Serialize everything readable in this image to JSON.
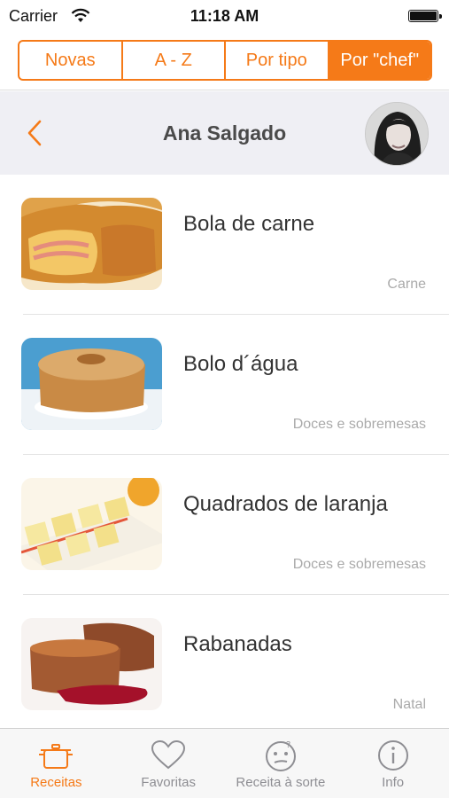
{
  "status_bar": {
    "carrier": "Carrier",
    "time": "11:18 AM"
  },
  "segments": [
    {
      "label": "Novas",
      "active": false
    },
    {
      "label": "A - Z",
      "active": false
    },
    {
      "label": "Por tipo",
      "active": false
    },
    {
      "label": "Por \"chef\"",
      "active": true
    }
  ],
  "chef": {
    "name": "Ana Salgado"
  },
  "recipes": [
    {
      "title": "Bola de carne",
      "category": "Carne"
    },
    {
      "title": "Bolo d´água",
      "category": "Doces e sobremesas"
    },
    {
      "title": "Quadrados de laranja",
      "category": "Doces e sobremesas"
    },
    {
      "title": "Rabanadas",
      "category": "Natal"
    }
  ],
  "tabs": [
    {
      "label": "Receitas",
      "icon": "pot-icon",
      "active": true
    },
    {
      "label": "Favoritas",
      "icon": "heart-icon",
      "active": false
    },
    {
      "label": "Receita à sorte",
      "icon": "thinking-face-icon",
      "active": false
    },
    {
      "label": "Info",
      "icon": "info-icon",
      "active": false
    }
  ],
  "colors": {
    "accent": "#f57a18",
    "header_bg": "#efeff4",
    "muted_text": "#aaaaaa"
  }
}
